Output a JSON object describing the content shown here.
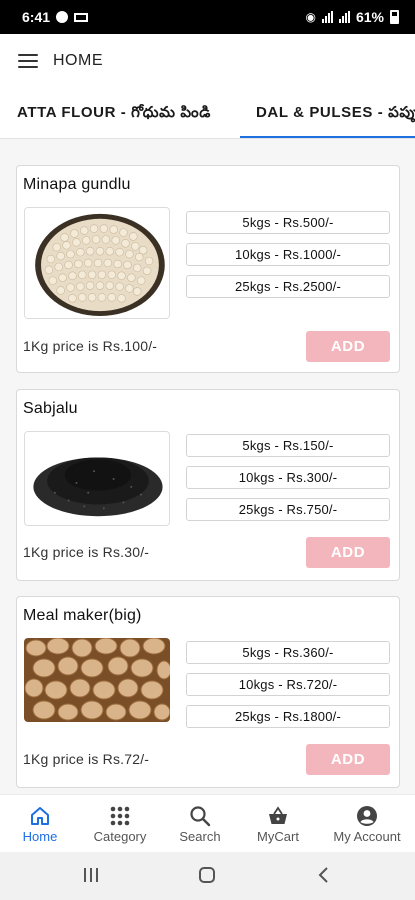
{
  "status_bar": {
    "time": "6:41",
    "battery": "61%"
  },
  "app_bar": {
    "title": "HOME"
  },
  "tabs": [
    {
      "label": "ATTA FLOUR - గోధుమ పిండి"
    },
    {
      "label": "DAL & PULSES - పప్పు"
    }
  ],
  "products": [
    {
      "name": "Minapa gundlu",
      "image": "white-gram-in-basket",
      "options": [
        "5kgs - Rs.500/-",
        "10kgs - Rs.1000/-",
        "25kgs - Rs.2500/-"
      ],
      "price_text": "1Kg price is Rs.100/-",
      "add_label": "ADD"
    },
    {
      "name": "Sabjalu",
      "image": "basil-seeds-pile",
      "options": [
        "5kgs - Rs.150/-",
        "10kgs - Rs.300/-",
        "25kgs - Rs.750/-"
      ],
      "price_text": "1Kg price is Rs.30/-",
      "add_label": "ADD"
    },
    {
      "name": "Meal maker(big)",
      "image": "soya-chunks",
      "options": [
        "5kgs - Rs.360/-",
        "10kgs - Rs.720/-",
        "25kgs - Rs.1800/-"
      ],
      "price_text": "1Kg price is Rs.72/-",
      "add_label": "ADD"
    }
  ],
  "bottom_nav": [
    {
      "label": "Home",
      "icon": "home-icon",
      "active": true
    },
    {
      "label": "Category",
      "icon": "grid-icon",
      "active": false
    },
    {
      "label": "Search",
      "icon": "search-icon",
      "active": false
    },
    {
      "label": "MyCart",
      "icon": "basket-icon",
      "active": false
    },
    {
      "label": "My Account",
      "icon": "account-icon",
      "active": false
    }
  ],
  "colors": {
    "accent": "#1e6fe0",
    "add_button": "#f4b6bd"
  }
}
